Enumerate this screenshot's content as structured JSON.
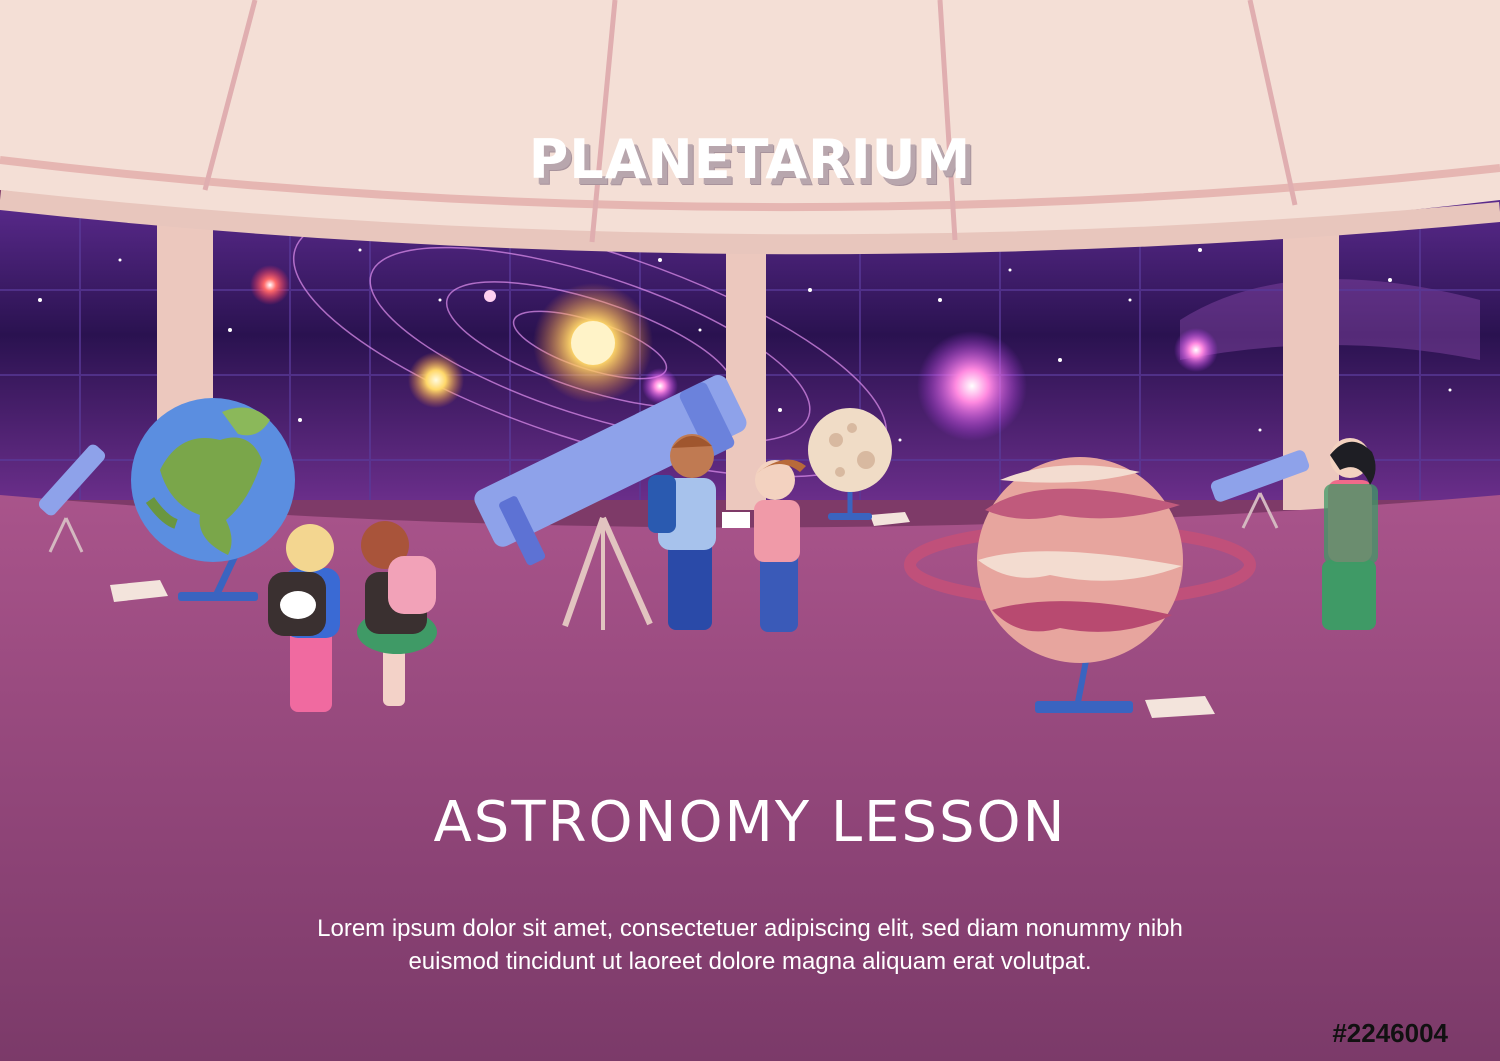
{
  "sign": {
    "text": "PLANETARIUM"
  },
  "headline": {
    "text": "ASTRONOMY LESSON"
  },
  "body_copy": {
    "line1": "Lorem ipsum dolor sit amet, consectetuer adipiscing elit, sed diam nonummy nibh",
    "line2": "euismod tincidunt ut laoreet dolore magna aliquam erat volutpat."
  },
  "stock_id": {
    "text": "#2246004"
  },
  "colors": {
    "ceiling": "#f3dcd4",
    "window_frame": "#ecc8be",
    "space": "#3a1660",
    "floor": "#a04e86",
    "telescope": "#8ea2ea",
    "earth_ocean": "#5b8ee0",
    "earth_land": "#7aa64a",
    "planet_band": "#c05a7c"
  }
}
